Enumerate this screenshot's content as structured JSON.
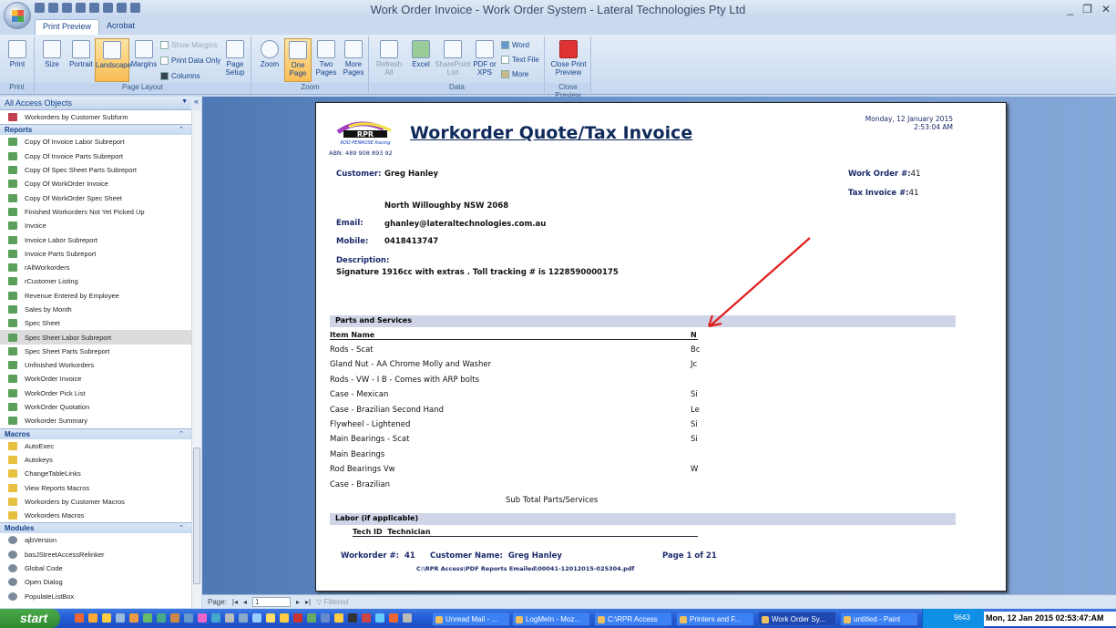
{
  "window": {
    "title": "Work Order Invoice - Work Order System - Lateral Technologies Pty Ltd",
    "min": "_",
    "restore": "❐",
    "close": "✕"
  },
  "tabs": [
    "Print Preview",
    "Acrobat"
  ],
  "ribbon": {
    "print": {
      "button": "Print",
      "group": "Print"
    },
    "page_layout": {
      "size": "Size",
      "portrait": "Portrait",
      "landscape": "Landscape",
      "margins": "Margins",
      "show_margins": "Show Margins",
      "print_data_only": "Print Data Only",
      "columns": "Columns",
      "page_setup": "Page Setup",
      "group": "Page Layout"
    },
    "zoom": {
      "zoom": "Zoom",
      "one_page": "One Page",
      "two_pages": "Two Pages",
      "more_pages": "More Pages",
      "group": "Zoom"
    },
    "data": {
      "refresh_all": "Refresh All",
      "excel": "Excel",
      "sharepoint_list": "SharePoint List",
      "pdf_xps": "PDF or XPS",
      "word": "Word",
      "text_file": "Text File",
      "more": "More",
      "group": "Data"
    },
    "close": {
      "close_print_preview": "Close Print Preview",
      "group": "Close Preview"
    }
  },
  "nav": {
    "header": "All Access Objects",
    "forms": [
      "Workorders by Customer Subform"
    ],
    "sections": [
      {
        "title": "Reports",
        "kind": "rep",
        "items": [
          "Copy Of Invoice Labor Subreport",
          "Copy Of Invoice Parts Subreport",
          "Copy Of Spec Sheet Parts Subreport",
          "Copy Of WorkOrder Invoice",
          "Copy Of WorkOrder Spec Sheet",
          "Finished Workorders Not Yet Picked Up",
          "Invoice",
          "Invoice Labor Subreport",
          "Invoice Parts Subreport",
          "rAllWorkorders",
          "rCustomer Listing",
          "Revenue Entered by Employee",
          "Sales by Month",
          "Spec Sheet",
          "Spec Sheet Labor Subreport",
          "Spec Sheet Parts Subreport",
          "Unfinished Workorders",
          "WorkOrder Invoice",
          "WorkOrder Pick List",
          "WorkOrder Quotation",
          "Workorder Summary"
        ]
      },
      {
        "title": "Macros",
        "kind": "mac",
        "items": [
          "AutoExec",
          "Autokeys",
          "ChangeTableLinks",
          "View Reports Macros",
          "Workorders by Customer Macros",
          "Workorders Macros"
        ]
      },
      {
        "title": "Modules",
        "kind": "mod",
        "items": [
          "ajbVersion",
          "basJStreetAccessRelinker",
          "Global Code",
          "Open Dialog",
          "PopulateListBox"
        ]
      }
    ],
    "selected": "Spec Sheet Labor Subreport"
  },
  "report": {
    "logo_text": "RPR",
    "logo_sub": "ROD PENROSE Racing",
    "abn": "ABN: 489 908 893 92",
    "title": "Workorder Quote/Tax Invoice",
    "date": "Monday, 12 January 2015",
    "time": "2:53:04 AM",
    "customer_label": "Customer:",
    "customer": "Greg Hanley",
    "address": "North Willoughby  NSW  2068",
    "email_label": "Email:",
    "email": "ghanley@lateraltechnologies.com.au",
    "mobile_label": "Mobile:",
    "mobile": "0418413747",
    "workorder_label": "Work Order #:",
    "workorder": "41",
    "tax_label": "Tax Invoice #:",
    "tax": "41",
    "description_label": "Description:",
    "description": "Signature 1916cc with extras . Toll tracking # is 1228590000175",
    "parts_header": "Parts and Services",
    "col_item": "Item Name",
    "col_n": "N",
    "parts": [
      {
        "name": "Rods - Scat",
        "n": "Bc"
      },
      {
        "name": "Gland Nut - AA Chrome Molly and Washer",
        "n": "Jc"
      },
      {
        "name": "Rods - VW - I B - Comes with ARP bolts",
        "n": ""
      },
      {
        "name": "Case - Mexican",
        "n": "Si"
      },
      {
        "name": "Case - Brazilian Second Hand",
        "n": "Le"
      },
      {
        "name": "Flywheel - Lightened",
        "n": "Si"
      },
      {
        "name": "Main Bearings - Scat",
        "n": "Si"
      },
      {
        "name": "Main Bearings",
        "n": ""
      },
      {
        "name": "Rod Bearings Vw",
        "n": "W"
      },
      {
        "name": "Case - Brazilian",
        "n": ""
      }
    ],
    "subtotal": "Sub Total Parts/Services",
    "labor_header": "Labor (if applicable)",
    "col_techid": "Tech ID",
    "col_tech": "Technician",
    "footer_wo_label": "Workorder #:",
    "footer_wo": "41",
    "footer_cust_label": "Customer Name:",
    "footer_cust": "Greg Hanley",
    "footer_page": "Page 1 of 21",
    "footer_path": "C:\\RPR Access\\PDF Reports Emailed\\00041-12012015-025304.pdf"
  },
  "status": {
    "page_label": "Page:",
    "page": "1",
    "filtered": "Filtered"
  },
  "taskbar": {
    "start": "start",
    "tasks": [
      "Unread Mail - ...",
      "LogMeIn - Moz...",
      "C:\\RPR Access",
      "Printers and F...",
      "Work Order Sy...",
      "untitled - Paint"
    ],
    "active": "Work Order Sy...",
    "tray": "9643",
    "clock": "Mon, 12 Jan 2015  02:53:47:AM"
  },
  "colors": {
    "accent": "#15428b",
    "annotation_arrow": "#e02020",
    "preview_bg": "#6e96cc"
  }
}
